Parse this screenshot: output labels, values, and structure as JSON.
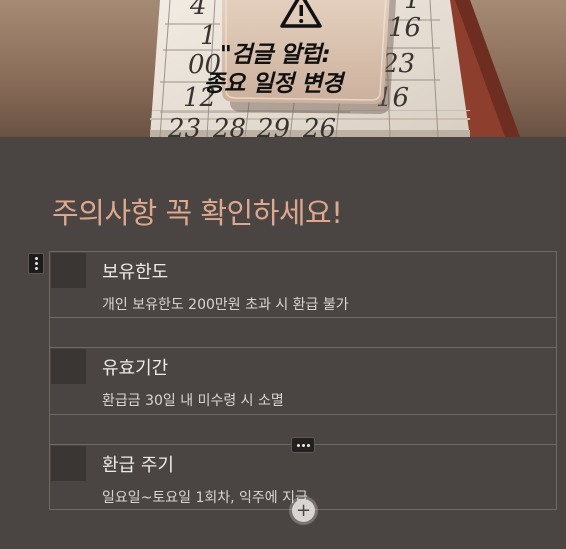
{
  "hero": {
    "sign_line1": "\"검글 알럽:",
    "sign_line2": "종요 일정 변경",
    "calendar_numbers": [
      "1",
      "16",
      "00",
      "23",
      "12",
      "16",
      "23",
      "28",
      "29",
      "26",
      "1",
      "4"
    ]
  },
  "notice": {
    "heading": "주의사항 꼭 확인하세요!"
  },
  "items": [
    {
      "title": "보유한도",
      "description": "개인 보유한도 200만원 초과 시 환급 불가"
    },
    {
      "title": "유효기간",
      "description": "환급금 30일 내 미수령 시 소멸"
    },
    {
      "title": "환급 주기",
      "description": "일요일~토요일 1회차, 익주에 지급"
    }
  ],
  "controls": {
    "add_symbol": "+"
  },
  "colors": {
    "background": "#4a4542",
    "heading": "#dca98f",
    "border": "#6e6965"
  }
}
